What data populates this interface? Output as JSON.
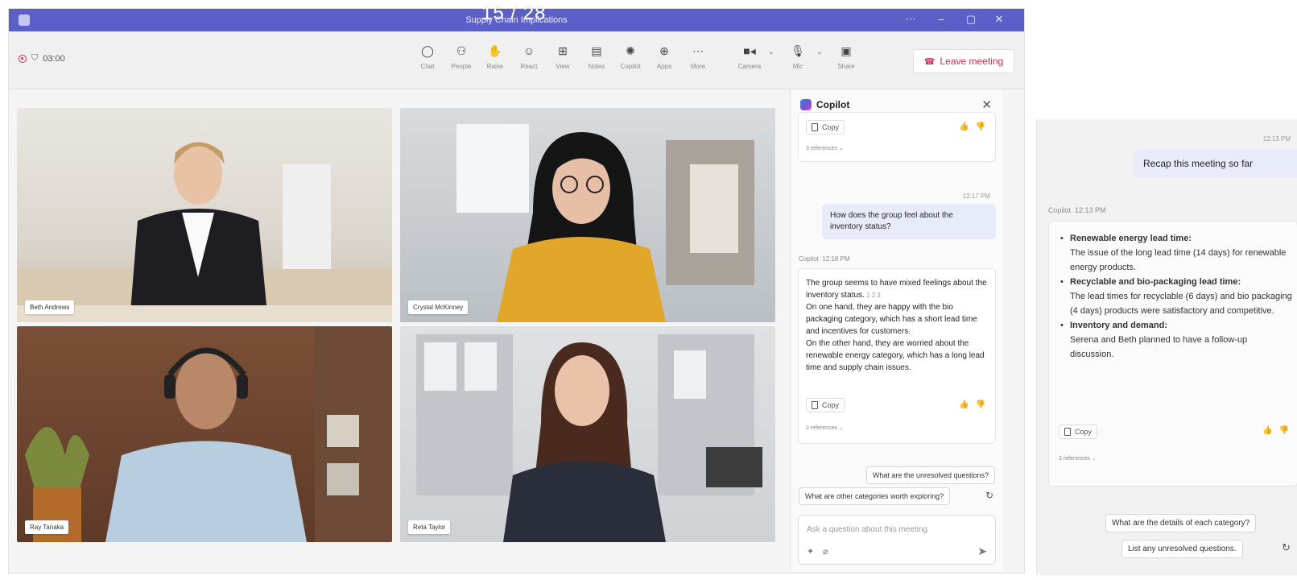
{
  "window": {
    "title": "Supply Chain Implications",
    "controls": [
      "⋯",
      "–",
      "▢",
      "✕"
    ]
  },
  "overlay": {
    "page_indicator": "15 / 28"
  },
  "toolbar": {
    "timer": "03:00",
    "buttons": [
      {
        "label": "Chat",
        "icon": "chat-icon",
        "glyph": "💬"
      },
      {
        "label": "People",
        "icon": "people-icon",
        "glyph": "👥"
      },
      {
        "label": "Raise",
        "icon": "raise-hand-icon",
        "glyph": "✋"
      },
      {
        "label": "React",
        "icon": "react-icon",
        "glyph": "☺"
      },
      {
        "label": "View",
        "icon": "view-icon",
        "glyph": "⊞"
      },
      {
        "label": "Notes",
        "icon": "notes-icon",
        "glyph": "🗒"
      },
      {
        "label": "Copilot",
        "icon": "copilot-icon",
        "glyph": "✺"
      },
      {
        "label": "Apps",
        "icon": "apps-icon",
        "glyph": "⊕"
      },
      {
        "label": "More",
        "icon": "more-icon",
        "glyph": "⋯"
      },
      {
        "label": "Camera",
        "icon": "camera-icon",
        "glyph": "🎥"
      },
      {
        "label": "Mic",
        "icon": "mic-icon",
        "glyph": "🎙"
      },
      {
        "label": "Share",
        "icon": "share-icon",
        "glyph": "⬆"
      }
    ],
    "leave_label": "Leave meeting"
  },
  "participants": [
    {
      "name": "Beth Andrews"
    },
    {
      "name": "Crystal McKinney"
    },
    {
      "name": "Ray Tanaka"
    },
    {
      "name": "Reta Taylor"
    }
  ],
  "copilot": {
    "title": "Copilot",
    "copy_label": "Copy",
    "refs_label": "3 references",
    "user_time": "12:17 PM",
    "user_question": "How does the group feel about the inventory status?",
    "ai_sender": "Copilot",
    "ai_time": "12:18 PM",
    "ai_answer_p1": "The group seems to have mixed feelings about the inventory status.",
    "ai_answer_p2": "On one hand, they are happy with the bio packaging category, which has a short lead time and incentives for customers.",
    "ai_answer_p3": "On the other hand, they are worried about the renewable energy category, which has a long lead time and supply chain issues.",
    "suggestions": [
      "What are the unresolved questions?",
      "What are other categories worth exploring?"
    ],
    "input_placeholder": "Ask a question about this meeting"
  },
  "zoom_panel": {
    "user_time": "12:13 PM",
    "user_message": "Recap this meeting so far",
    "ai_sender": "Copilot",
    "ai_time": "12:13 PM",
    "bullets": [
      {
        "heading": "Renewable energy lead time:",
        "body": "The issue of the long lead time (14 days) for renewable energy products."
      },
      {
        "heading": "Recyclable and bio-packaging lead time:",
        "body": "The lead times for recyclable (6 days) and bio packaging (4 days) products were satisfactory and competitive."
      },
      {
        "heading": "Inventory and demand:",
        "body": "Serena and Beth planned to have a follow-up discussion."
      }
    ],
    "copy_label": "Copy",
    "refs_label": "3 references",
    "suggestions": [
      "What are the details of each category?",
      "List any unresolved questions."
    ]
  },
  "colors": {
    "accent": "#5b5fc7",
    "leave": "#c4314b",
    "user_bubble": "#e8ebfa"
  }
}
